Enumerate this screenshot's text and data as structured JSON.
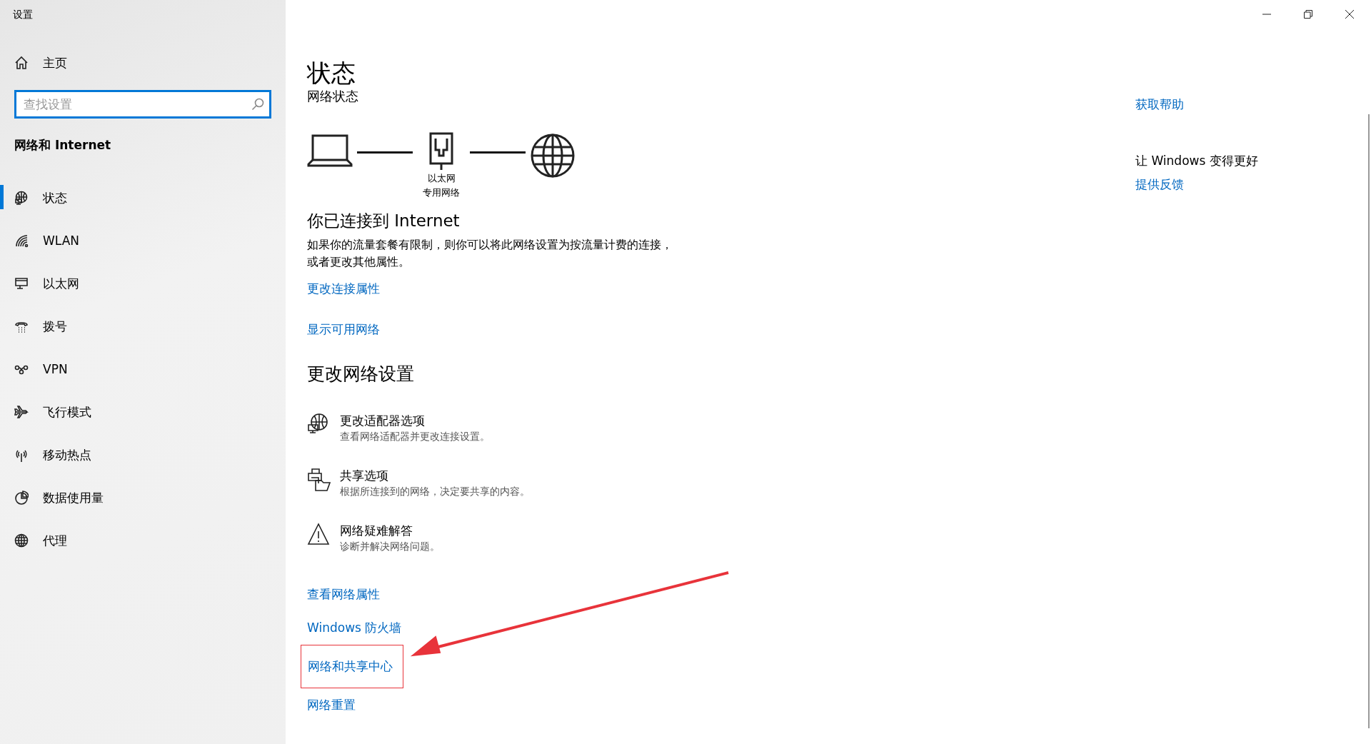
{
  "window": {
    "title": "设置"
  },
  "sidebar": {
    "home": "主页",
    "search": {
      "placeholder": "查找设置"
    },
    "category": "网络和 Internet",
    "items": [
      {
        "label": "状态",
        "selected": true
      },
      {
        "label": "WLAN",
        "selected": false
      },
      {
        "label": "以太网",
        "selected": false
      },
      {
        "label": "拨号",
        "selected": false
      },
      {
        "label": "VPN",
        "selected": false
      },
      {
        "label": "飞行模式",
        "selected": false
      },
      {
        "label": "移动热点",
        "selected": false
      },
      {
        "label": "数据使用量",
        "selected": false
      },
      {
        "label": "代理",
        "selected": false
      }
    ]
  },
  "main": {
    "title": "状态",
    "subtitle": "网络状态",
    "diagram": {
      "adapter": "以太网",
      "network": "专用网络"
    },
    "connection": {
      "heading": "你已连接到 Internet",
      "description": "如果你的流量套餐有限制，则你可以将此网络设置为按流量计费的连接，或者更改其他属性。"
    },
    "links": [
      "更改连接属性",
      "显示可用网络"
    ],
    "section_heading": "更改网络设置",
    "options": [
      {
        "title": "更改适配器选项",
        "description": "查看网络适配器并更改连接设置。"
      },
      {
        "title": "共享选项",
        "description": "根据所连接到的网络，决定要共享的内容。"
      },
      {
        "title": "网络疑难解答",
        "description": "诊断并解决网络问题。"
      }
    ],
    "more_links": [
      {
        "label": "查看网络属性",
        "highlighted": false
      },
      {
        "label": "Windows 防火墙",
        "highlighted": false
      },
      {
        "label": "网络和共享中心",
        "highlighted": true
      },
      {
        "label": "网络重置",
        "highlighted": false
      }
    ]
  },
  "aside": {
    "help_link": "获取帮助",
    "feedback_heading": "让 Windows 变得更好",
    "feedback_link": "提供反馈"
  }
}
